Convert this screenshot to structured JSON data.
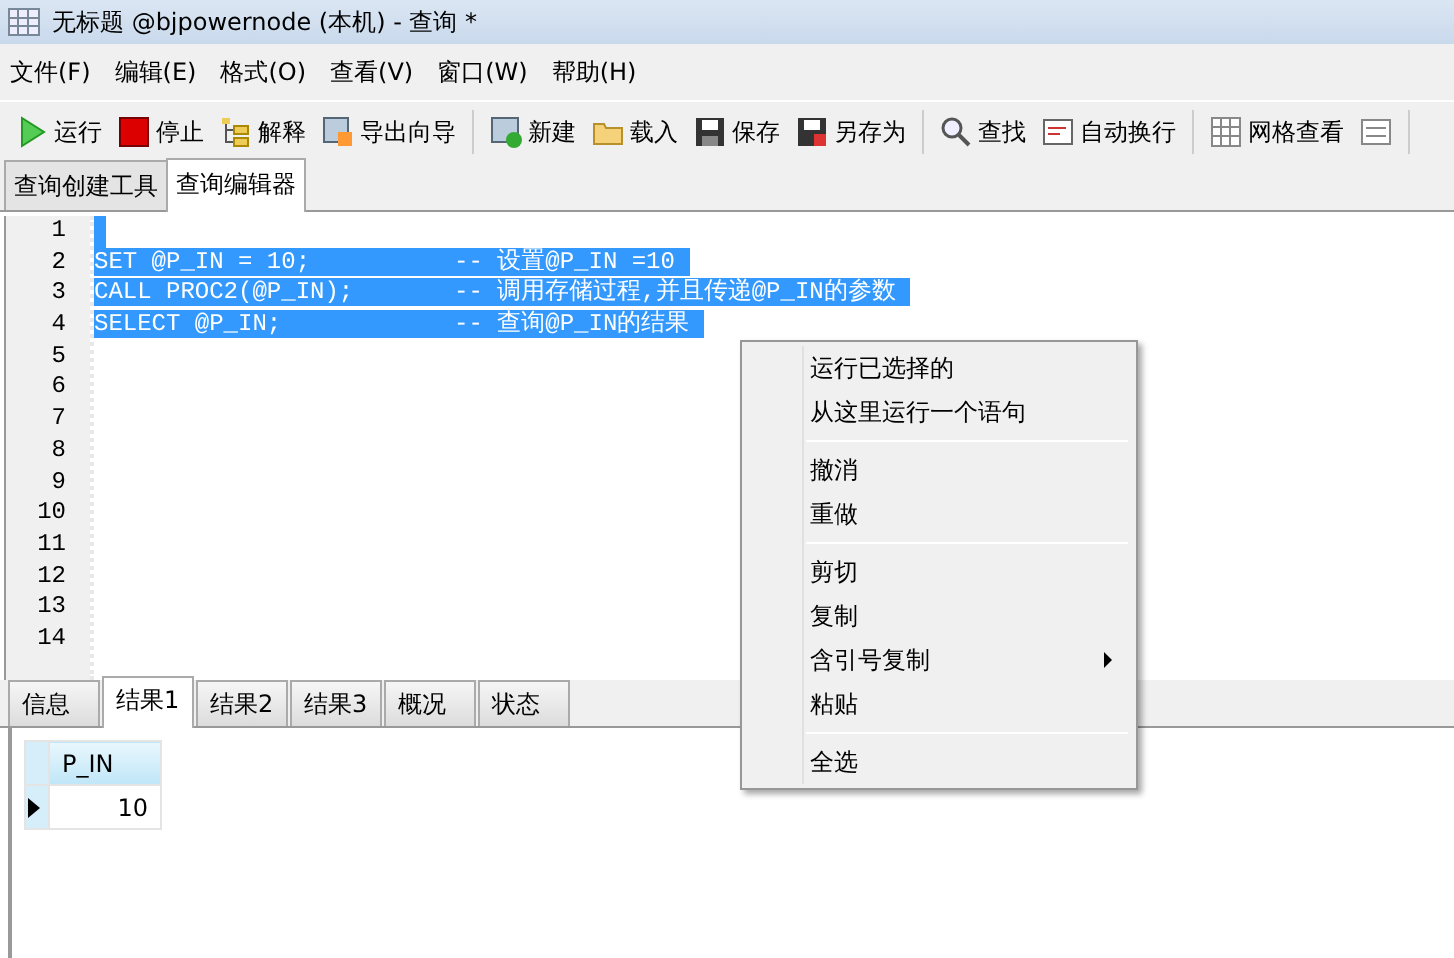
{
  "window": {
    "title": "无标题 @bjpowernode (本机) - 查询 *"
  },
  "menu": [
    "文件(F)",
    "编辑(E)",
    "格式(O)",
    "查看(V)",
    "窗口(W)",
    "帮助(H)"
  ],
  "toolbar": [
    [
      {
        "kind": "run",
        "label": "运行"
      },
      {
        "kind": "stop",
        "label": "停止"
      },
      {
        "kind": "explain",
        "label": "解释"
      },
      {
        "kind": "export",
        "label": "导出向导"
      }
    ],
    [
      {
        "kind": "new",
        "label": "新建"
      },
      {
        "kind": "load",
        "label": "载入"
      },
      {
        "kind": "save",
        "label": "保存"
      },
      {
        "kind": "saveas",
        "label": "另存为"
      }
    ],
    [
      {
        "kind": "find",
        "label": "查找"
      },
      {
        "kind": "wrap",
        "label": "自动换行"
      }
    ],
    [
      {
        "kind": "grid",
        "label": "网格查看"
      },
      {
        "kind": "form"
      }
    ]
  ],
  "tabs": [
    {
      "label": "查询创建工具",
      "selected": false
    },
    {
      "label": "查询编辑器",
      "selected": true
    }
  ],
  "editor": {
    "lines": [
      {
        "number": "1",
        "selected": true
      },
      {
        "number": "2",
        "code": "SET @P_IN = 10;          ",
        "comment": "-- 设置@P_IN =10 ",
        "selected": true
      },
      {
        "number": "3",
        "code": "CALL PROC2(@P_IN);       ",
        "comment": "-- 调用存储过程,并且传递@P_IN的参数 ",
        "selected": true
      },
      {
        "number": "4",
        "code": "SELECT @P_IN;            ",
        "comment": "-- 查询@P_IN的结果 ",
        "selected": true
      },
      {
        "number": "5",
        "selected": false
      },
      {
        "number": "6",
        "selected": false
      },
      {
        "number": "7",
        "selected": false
      },
      {
        "number": "8",
        "selected": false
      },
      {
        "number": "9",
        "selected": false
      },
      {
        "number": "10",
        "selected": false
      },
      {
        "number": "11",
        "selected": false
      },
      {
        "number": "12",
        "selected": false
      },
      {
        "number": "13",
        "selected": false
      },
      {
        "number": "14",
        "selected": false
      }
    ]
  },
  "result_tabs": [
    {
      "label": "信息",
      "selected": false
    },
    {
      "label": "结果1",
      "selected": true
    },
    {
      "label": "结果2",
      "selected": false
    },
    {
      "label": "结果3",
      "selected": false
    },
    {
      "label": "概况",
      "selected": false
    },
    {
      "label": "状态",
      "selected": false
    }
  ],
  "result_grid": {
    "columns": [
      "P_IN"
    ],
    "rows": [
      {
        "cells": [
          "10"
        ],
        "current": true
      }
    ]
  },
  "context_menu": [
    [
      {
        "label": "运行已选择的",
        "submenu": false
      },
      {
        "label": "从这里运行一个语句",
        "submenu": false
      }
    ],
    [
      {
        "label": "撤消",
        "submenu": false
      },
      {
        "label": "重做",
        "submenu": false
      }
    ],
    [
      {
        "label": "剪切",
        "submenu": false
      },
      {
        "label": "复制",
        "submenu": false
      },
      {
        "label": "含引号复制",
        "submenu": true
      },
      {
        "label": "粘贴",
        "submenu": false
      }
    ],
    [
      {
        "label": "全选",
        "submenu": false
      }
    ]
  ]
}
